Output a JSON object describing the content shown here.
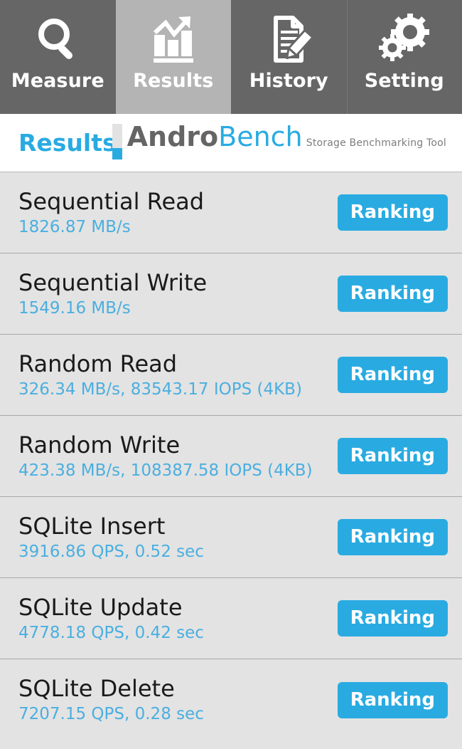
{
  "tabs": [
    {
      "label": "Measure",
      "icon": "magnifier-icon",
      "active": false
    },
    {
      "label": "Results",
      "icon": "bar-chart-trend-icon",
      "active": true
    },
    {
      "label": "History",
      "icon": "document-pencil-icon",
      "active": false
    },
    {
      "label": "Setting",
      "icon": "gears-icon",
      "active": false
    }
  ],
  "header": {
    "title": "Results",
    "brand_primary": "Andro",
    "brand_secondary": "Bench",
    "tagline": "Storage Benchmarking Tool"
  },
  "colors": {
    "accent_blue": "#29abe2",
    "value_blue": "#4aafe0",
    "tab_inactive": "#666666",
    "tab_active": "#b4b4b4",
    "row_background": "#e3e3e3",
    "row_divider": "#a9a9a9",
    "brand_gray": "#656565"
  },
  "results": [
    {
      "name": "Sequential Read",
      "value": "1826.87 MB/s",
      "action": "Ranking"
    },
    {
      "name": "Sequential Write",
      "value": "1549.16 MB/s",
      "action": "Ranking"
    },
    {
      "name": "Random Read",
      "value": "326.34 MB/s, 83543.17 IOPS (4KB)",
      "action": "Ranking"
    },
    {
      "name": "Random Write",
      "value": "423.38 MB/s, 108387.58 IOPS (4KB)",
      "action": "Ranking"
    },
    {
      "name": "SQLite Insert",
      "value": "3916.86 QPS, 0.52 sec",
      "action": "Ranking"
    },
    {
      "name": "SQLite Update",
      "value": "4778.18 QPS, 0.42 sec",
      "action": "Ranking"
    },
    {
      "name": "SQLite Delete",
      "value": "7207.15 QPS, 0.28 sec",
      "action": "Ranking"
    }
  ]
}
